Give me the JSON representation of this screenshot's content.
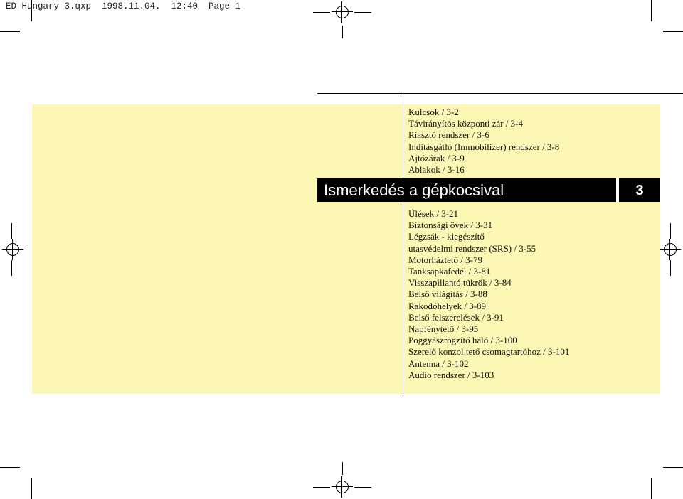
{
  "slug": "ED Hungary 3.qxp  1998.11.04.  12:40  Page 1",
  "chapter": {
    "title": "Ismerkedés a gépkocsival",
    "number": "3"
  },
  "toc_top": [
    "Kulcsok / 3-2",
    "Távirányítós központi zár / 3-4",
    "Riasztó rendszer / 3-6",
    "Indításgátló (Immobilizer) rendszer / 3-8",
    "Ajtózárak / 3-9",
    "Ablakok / 3-16"
  ],
  "toc_bottom": [
    "Ülések / 3-21",
    "Biztonsági övek / 3-31",
    "Légzsák - kiegészítő",
    "utasvédelmi rendszer (SRS) / 3-55",
    "Motorháztető / 3-79",
    "Tanksapkafedél / 3-81",
    "Visszapillantó tükrök / 3-84",
    "Belső világítás / 3-88",
    "Rakodóhelyek / 3-89",
    "Belső felszerelések / 3-91",
    "Napfénytető / 3-95",
    "Poggyászrögzítő háló / 3-100",
    "Szerelő konzol tető csomagtartóhoz / 3-101",
    "Antenna / 3-102",
    "Audio rendszer / 3-103"
  ]
}
